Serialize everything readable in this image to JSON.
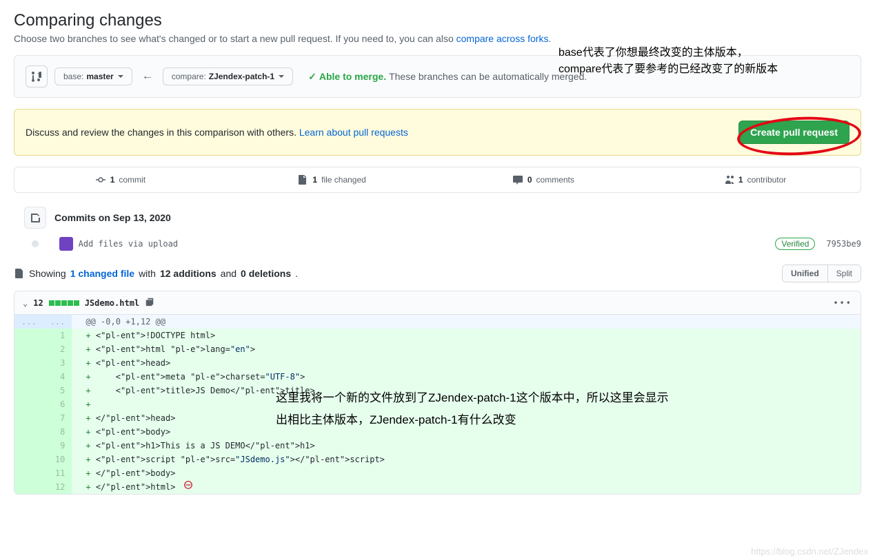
{
  "header": {
    "title": "Comparing changes",
    "subtitle_pre": "Choose two branches to see what's changed or to start a new pull request. If you need to, you can also ",
    "subtitle_link": "compare across forks",
    "subtitle_post": "."
  },
  "annotations": {
    "branch_note_line1": "base代表了你想最终改变的主体版本，",
    "branch_note_line2": "compare代表了要参考的已经改变了的新版本",
    "diff_note_line1": "这里我将一个新的文件放到了ZJendex-patch-1这个版本中，所以这里会显示",
    "diff_note_line2": "出相比主体版本，ZJendex-patch-1有什么改变"
  },
  "compare": {
    "base_label": "base:",
    "base_value": "master",
    "compare_label": "compare:",
    "compare_value": "ZJendex-patch-1",
    "able_to_merge": "Able to merge.",
    "merge_msg": "These branches can be automatically merged."
  },
  "discuss": {
    "text": "Discuss and review the changes in this comparison with others. ",
    "link": "Learn about pull requests",
    "button": "Create pull request"
  },
  "stats": {
    "commits_count": "1",
    "commits_label": "commit",
    "files_count": "1",
    "files_label": "file changed",
    "comments_count": "0",
    "comments_label": "comments",
    "contributors_count": "1",
    "contributors_label": "contributor"
  },
  "timeline": {
    "date_label": "Commits on Sep 13, 2020",
    "commit_msg": "Add files via upload",
    "verified": "Verified",
    "sha": "7953be9"
  },
  "diff": {
    "showing": "Showing",
    "changed_files": "1 changed file",
    "with": "with",
    "additions": "12 additions",
    "and": "and",
    "deletions": "0 deletions",
    "unified": "Unified",
    "split": "Split",
    "count": "12",
    "filename": "JSdemo.html",
    "hunk": "@@ -0,0 +1,12 @@",
    "lines": [
      {
        "n": "1",
        "html": "<!DOCTYPE html>"
      },
      {
        "n": "2",
        "html": "<html lang=\"en\">"
      },
      {
        "n": "3",
        "html": "<head>"
      },
      {
        "n": "4",
        "html": "    <meta charset=\"UTF-8\">"
      },
      {
        "n": "5",
        "html": "    <title>JS Demo</title>"
      },
      {
        "n": "6",
        "html": ""
      },
      {
        "n": "7",
        "html": "</head>"
      },
      {
        "n": "8",
        "html": "<body>"
      },
      {
        "n": "9",
        "html": "<h1>This is a JS DEMO</h1>"
      },
      {
        "n": "10",
        "html": "<script src=\"JSdemo.js\"></scr"
      },
      {
        "n": "11",
        "html": "</body>"
      },
      {
        "n": "12",
        "html": "</html>"
      }
    ]
  },
  "watermark": "https://blog.csdn.net/ZJendex"
}
